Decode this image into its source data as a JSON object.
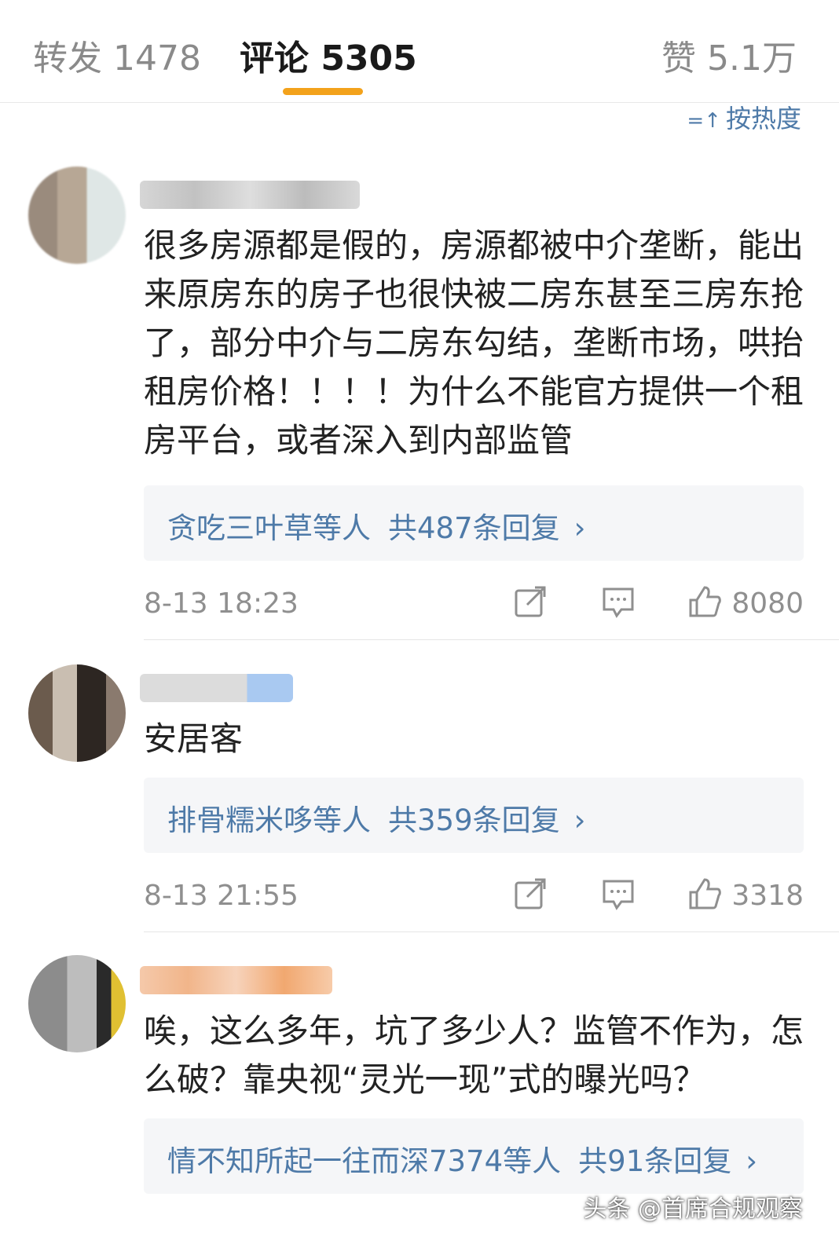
{
  "tabs": {
    "repost": "转发 1478",
    "comment": "评论 5305",
    "like": "赞 5.1万"
  },
  "sort": {
    "icon": "=↑",
    "label": "按热度"
  },
  "comments": [
    {
      "text": "很多房源都是假的，房源都被中介垄断，能出来原房东的房子也很快被二房东甚至三房东抢了，部分中介与二房东勾结，垄断市场，哄抬租房价格！！！！为什么不能官方提供一个租房平台，或者深入到内部监管",
      "replies_from": "贪吃三叶草等人",
      "replies_count": "共487条回复",
      "chevron": "›",
      "time": "8-13 18:23",
      "likes": "8080"
    },
    {
      "text": "安居客",
      "replies_from": "排骨糯米哆等人",
      "replies_count": "共359条回复",
      "chevron": "›",
      "time": "8-13 21:55",
      "likes": "3318"
    },
    {
      "text": "唉，这么多年，坑了多少人？监管不作为，怎么破？靠央视“灵光一现”式的曝光吗？",
      "replies_from": "情不知所起一往而深7374等人",
      "replies_count": "共91条回复",
      "chevron": "›"
    }
  ],
  "watermark": "头条 @首席合规观察",
  "icons": [
    "share-icon",
    "reply-icon",
    "thumbs-up-icon",
    "sort-icon",
    "chevron-right-icon"
  ],
  "colors": {
    "accent": "#f3a21b",
    "link": "#4e7aa8",
    "muted": "#8f8f8f"
  }
}
